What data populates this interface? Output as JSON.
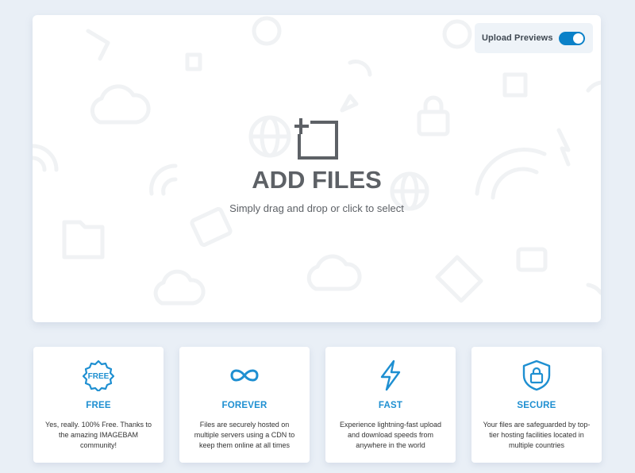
{
  "upload": {
    "title": "ADD FILES",
    "subtitle": "Simply drag and drop or click to select",
    "icon": "add-files-icon"
  },
  "preview_toggle": {
    "label": "Upload Previews",
    "enabled": true,
    "accent_color": "#0b81c8"
  },
  "features": [
    {
      "icon": "free-badge-icon",
      "icon_text": "FREE",
      "title": "FREE",
      "text": "Yes, really. 100% Free. Thanks to the amazing IMAGEBAM community!"
    },
    {
      "icon": "infinity-icon",
      "title": "FOREVER",
      "text": "Files are securely hosted on multiple servers using a CDN to keep them online at all times"
    },
    {
      "icon": "lightning-icon",
      "title": "FAST",
      "text": "Experience lightning-fast upload and download speeds from anywhere in the world"
    },
    {
      "icon": "shield-lock-icon",
      "title": "SECURE",
      "text": "Your files are safeguarded by top-tier hosting facilities located in multiple countries"
    }
  ],
  "colors": {
    "feature_title": "#1e8fd1",
    "background": "#e9eff6"
  }
}
